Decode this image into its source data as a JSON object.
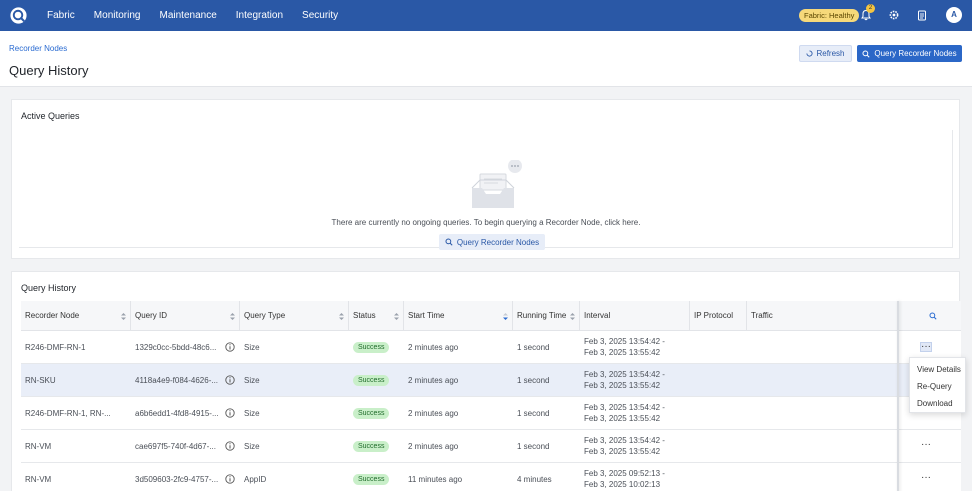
{
  "nav": {
    "items": [
      "Fabric",
      "Monitoring",
      "Maintenance",
      "Integration",
      "Security"
    ],
    "health_label": "Fabric: Healthy",
    "notification_count": "2",
    "avatar_initial": "A"
  },
  "header": {
    "breadcrumb": "Recorder Nodes",
    "title": "Query History",
    "refresh_label": "Refresh",
    "query_label": "Query Recorder Nodes"
  },
  "active": {
    "title": "Active Queries",
    "empty_text": "There are currently no ongoing queries. To begin querying a Recorder Node, click here.",
    "button_label": "Query Recorder Nodes"
  },
  "history": {
    "title": "Query History",
    "columns": [
      "Recorder Node",
      "Query ID",
      "Query Type",
      "Status",
      "Start Time",
      "Running Time",
      "Interval",
      "IP Protocol",
      "Traffic"
    ],
    "rows": [
      {
        "node": "R246-DMF-RN-1",
        "id": "1329c0cc-5bdd-48c6...",
        "type": "Size",
        "status": "Success",
        "start": "2 minutes ago",
        "running": "1 second",
        "interval_from": "Feb 3, 2025 13:54:42 -",
        "interval_to": "Feb 3, 2025 13:55:42"
      },
      {
        "node": "RN-SKU",
        "id": "4118a4e9-f084-4626-...",
        "type": "Size",
        "status": "Success",
        "start": "2 minutes ago",
        "running": "1 second",
        "interval_from": "Feb 3, 2025 13:54:42 -",
        "interval_to": "Feb 3, 2025 13:55:42"
      },
      {
        "node": "R246-DMF-RN-1, RN-...",
        "id": "a6b6edd1-4fd8-4915-...",
        "type": "Size",
        "status": "Success",
        "start": "2 minutes ago",
        "running": "1 second",
        "interval_from": "Feb 3, 2025 13:54:42 -",
        "interval_to": "Feb 3, 2025 13:55:42"
      },
      {
        "node": "RN-VM",
        "id": "cae697f5-740f-4d67-...",
        "type": "Size",
        "status": "Success",
        "start": "2 minutes ago",
        "running": "1 second",
        "interval_from": "Feb 3, 2025 13:54:42 -",
        "interval_to": "Feb 3, 2025 13:55:42"
      },
      {
        "node": "RN-VM",
        "id": "3d509603-2fc9-4757-...",
        "type": "AppID",
        "status": "Success",
        "start": "11 minutes ago",
        "running": "4 minutes",
        "interval_from": "Feb 3, 2025 09:52:13 -",
        "interval_to": "Feb 3, 2025 10:02:13"
      }
    ],
    "more_label": "···",
    "menu": [
      "View Details",
      "Re-Query",
      "Download"
    ]
  },
  "colors": {
    "brand": "#2a58a6",
    "primary_button": "#2b67c7",
    "success": "#c9efc9"
  }
}
